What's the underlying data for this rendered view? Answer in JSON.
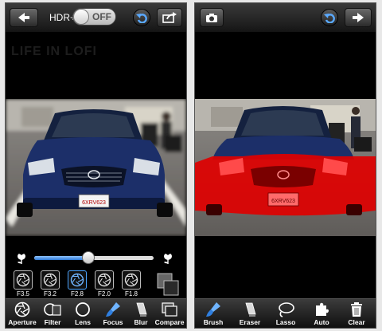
{
  "left_screen": {
    "hdr_label": "HDR+",
    "hdr_toggle": "OFF",
    "watermark": "LIFE IN LOFI",
    "license_plate": "6XRV623",
    "fstops": [
      "F3.5",
      "F3.2",
      "F2.8",
      "F2.0",
      "F1.8"
    ],
    "selected_fstop": "F2.8",
    "aperture_slider_value": 0.45,
    "tools": [
      "Aperture",
      "Filter",
      "Lens",
      "Focus",
      "Blur",
      "Compare"
    ],
    "selected_tool": "Focus"
  },
  "right_screen": {
    "license_plate": "6XRV623",
    "tools": [
      "Brush",
      "Eraser",
      "Lasso",
      "Auto",
      "Clear"
    ],
    "selected_tool": "Brush",
    "mask_color": "#e00000"
  },
  "colors": {
    "accent": "#2d79d6",
    "car_blue": "#1a2a5a",
    "mask_red": "#e00000"
  }
}
